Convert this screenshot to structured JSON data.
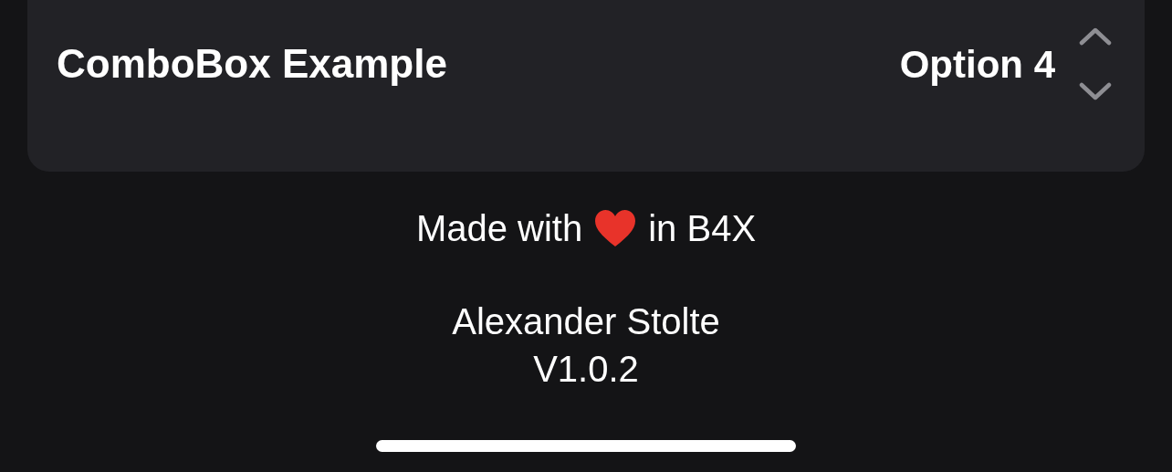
{
  "combobox": {
    "label": "ComboBox Example",
    "value": "Option 4"
  },
  "footer": {
    "made_with": "Made with",
    "in_text": "in B4X",
    "author": "Alexander Stolte",
    "version": "V1.0.2"
  }
}
